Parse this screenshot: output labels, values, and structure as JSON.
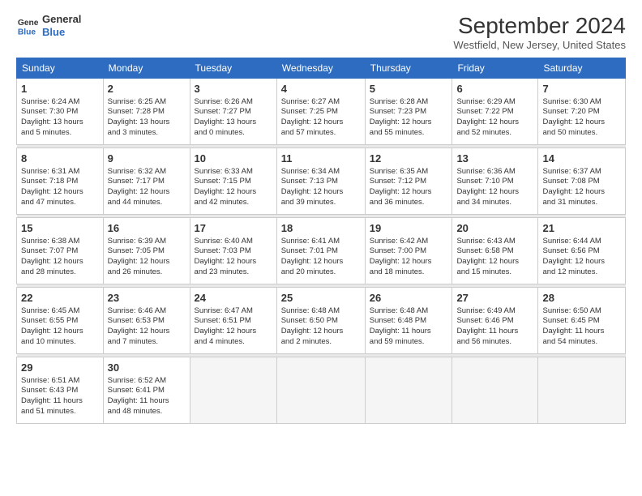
{
  "header": {
    "logo_line1": "General",
    "logo_line2": "Blue",
    "month": "September 2024",
    "location": "Westfield, New Jersey, United States"
  },
  "columns": [
    "Sunday",
    "Monday",
    "Tuesday",
    "Wednesday",
    "Thursday",
    "Friday",
    "Saturday"
  ],
  "weeks": [
    [
      {
        "day": "1",
        "detail": "Sunrise: 6:24 AM\nSunset: 7:30 PM\nDaylight: 13 hours\nand 5 minutes."
      },
      {
        "day": "2",
        "detail": "Sunrise: 6:25 AM\nSunset: 7:28 PM\nDaylight: 13 hours\nand 3 minutes."
      },
      {
        "day": "3",
        "detail": "Sunrise: 6:26 AM\nSunset: 7:27 PM\nDaylight: 13 hours\nand 0 minutes."
      },
      {
        "day": "4",
        "detail": "Sunrise: 6:27 AM\nSunset: 7:25 PM\nDaylight: 12 hours\nand 57 minutes."
      },
      {
        "day": "5",
        "detail": "Sunrise: 6:28 AM\nSunset: 7:23 PM\nDaylight: 12 hours\nand 55 minutes."
      },
      {
        "day": "6",
        "detail": "Sunrise: 6:29 AM\nSunset: 7:22 PM\nDaylight: 12 hours\nand 52 minutes."
      },
      {
        "day": "7",
        "detail": "Sunrise: 6:30 AM\nSunset: 7:20 PM\nDaylight: 12 hours\nand 50 minutes."
      }
    ],
    [
      {
        "day": "8",
        "detail": "Sunrise: 6:31 AM\nSunset: 7:18 PM\nDaylight: 12 hours\nand 47 minutes."
      },
      {
        "day": "9",
        "detail": "Sunrise: 6:32 AM\nSunset: 7:17 PM\nDaylight: 12 hours\nand 44 minutes."
      },
      {
        "day": "10",
        "detail": "Sunrise: 6:33 AM\nSunset: 7:15 PM\nDaylight: 12 hours\nand 42 minutes."
      },
      {
        "day": "11",
        "detail": "Sunrise: 6:34 AM\nSunset: 7:13 PM\nDaylight: 12 hours\nand 39 minutes."
      },
      {
        "day": "12",
        "detail": "Sunrise: 6:35 AM\nSunset: 7:12 PM\nDaylight: 12 hours\nand 36 minutes."
      },
      {
        "day": "13",
        "detail": "Sunrise: 6:36 AM\nSunset: 7:10 PM\nDaylight: 12 hours\nand 34 minutes."
      },
      {
        "day": "14",
        "detail": "Sunrise: 6:37 AM\nSunset: 7:08 PM\nDaylight: 12 hours\nand 31 minutes."
      }
    ],
    [
      {
        "day": "15",
        "detail": "Sunrise: 6:38 AM\nSunset: 7:07 PM\nDaylight: 12 hours\nand 28 minutes."
      },
      {
        "day": "16",
        "detail": "Sunrise: 6:39 AM\nSunset: 7:05 PM\nDaylight: 12 hours\nand 26 minutes."
      },
      {
        "day": "17",
        "detail": "Sunrise: 6:40 AM\nSunset: 7:03 PM\nDaylight: 12 hours\nand 23 minutes."
      },
      {
        "day": "18",
        "detail": "Sunrise: 6:41 AM\nSunset: 7:01 PM\nDaylight: 12 hours\nand 20 minutes."
      },
      {
        "day": "19",
        "detail": "Sunrise: 6:42 AM\nSunset: 7:00 PM\nDaylight: 12 hours\nand 18 minutes."
      },
      {
        "day": "20",
        "detail": "Sunrise: 6:43 AM\nSunset: 6:58 PM\nDaylight: 12 hours\nand 15 minutes."
      },
      {
        "day": "21",
        "detail": "Sunrise: 6:44 AM\nSunset: 6:56 PM\nDaylight: 12 hours\nand 12 minutes."
      }
    ],
    [
      {
        "day": "22",
        "detail": "Sunrise: 6:45 AM\nSunset: 6:55 PM\nDaylight: 12 hours\nand 10 minutes."
      },
      {
        "day": "23",
        "detail": "Sunrise: 6:46 AM\nSunset: 6:53 PM\nDaylight: 12 hours\nand 7 minutes."
      },
      {
        "day": "24",
        "detail": "Sunrise: 6:47 AM\nSunset: 6:51 PM\nDaylight: 12 hours\nand 4 minutes."
      },
      {
        "day": "25",
        "detail": "Sunrise: 6:48 AM\nSunset: 6:50 PM\nDaylight: 12 hours\nand 2 minutes."
      },
      {
        "day": "26",
        "detail": "Sunrise: 6:48 AM\nSunset: 6:48 PM\nDaylight: 11 hours\nand 59 minutes."
      },
      {
        "day": "27",
        "detail": "Sunrise: 6:49 AM\nSunset: 6:46 PM\nDaylight: 11 hours\nand 56 minutes."
      },
      {
        "day": "28",
        "detail": "Sunrise: 6:50 AM\nSunset: 6:45 PM\nDaylight: 11 hours\nand 54 minutes."
      }
    ],
    [
      {
        "day": "29",
        "detail": "Sunrise: 6:51 AM\nSunset: 6:43 PM\nDaylight: 11 hours\nand 51 minutes."
      },
      {
        "day": "30",
        "detail": "Sunrise: 6:52 AM\nSunset: 6:41 PM\nDaylight: 11 hours\nand 48 minutes."
      },
      null,
      null,
      null,
      null,
      null
    ]
  ]
}
